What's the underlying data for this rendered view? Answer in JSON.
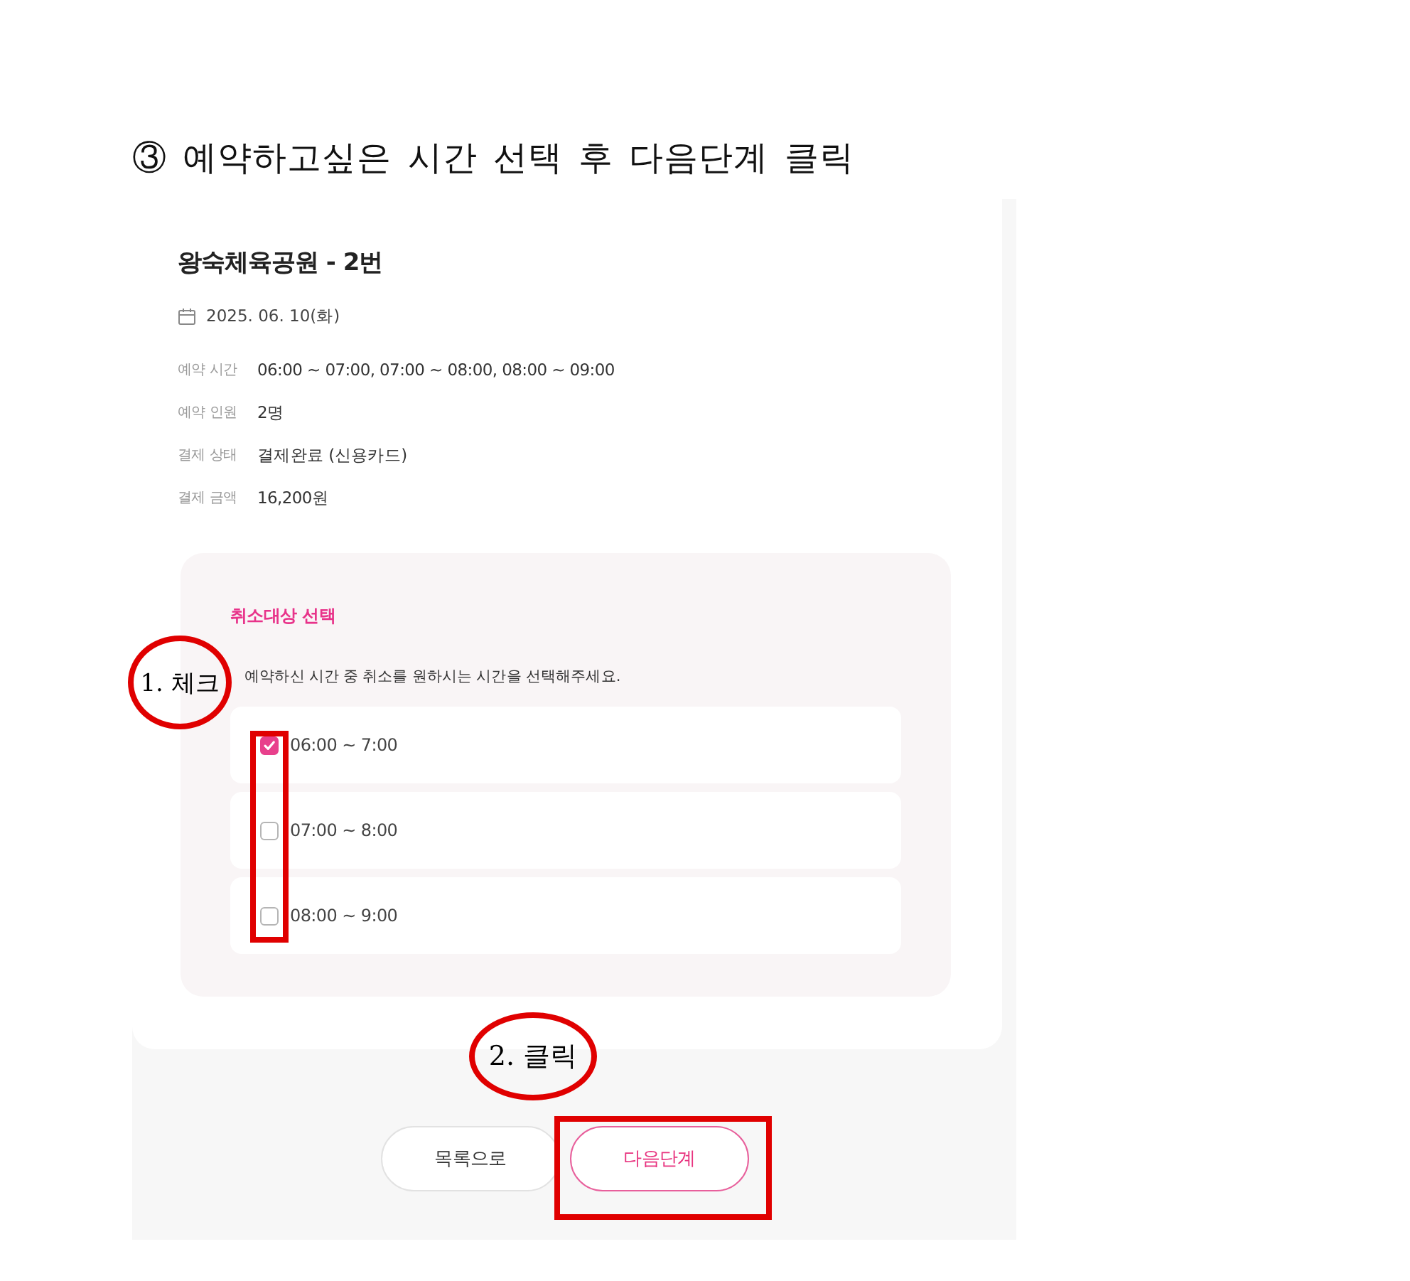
{
  "heading": "③ 예약하고싶은 시간 선택 후 다음단계 클릭",
  "booking": {
    "title": "왕숙체육공원 - 2번",
    "date": "2025. 06. 10(화)",
    "details": [
      {
        "label": "예약 시간",
        "value": "06:00 ~ 07:00, 07:00 ~ 08:00, 08:00 ~ 09:00"
      },
      {
        "label": "예약 인원",
        "value": "2명"
      },
      {
        "label": "결제 상태",
        "value": "결제완료 (신용카드)"
      },
      {
        "label": "결제 금액",
        "value": "16,200원"
      }
    ]
  },
  "cancel_section": {
    "title": "취소대상 선택",
    "instruction": "예약하신 시간 중 취소를 원하시는 시간을 선택해주세요.",
    "options": [
      {
        "label": "06:00 ~ 7:00",
        "checked": true
      },
      {
        "label": "07:00 ~ 8:00",
        "checked": false
      },
      {
        "label": "08:00 ~ 9:00",
        "checked": false
      }
    ]
  },
  "buttons": [
    {
      "label": "목록으로",
      "kind": "secondary"
    },
    {
      "label": "다음단계",
      "kind": "primary"
    }
  ],
  "annotations": [
    {
      "kind": "circle",
      "text": "1. 체크"
    },
    {
      "kind": "frame"
    },
    {
      "kind": "circle",
      "text": "2. 클릭"
    },
    {
      "kind": "frame"
    }
  ]
}
